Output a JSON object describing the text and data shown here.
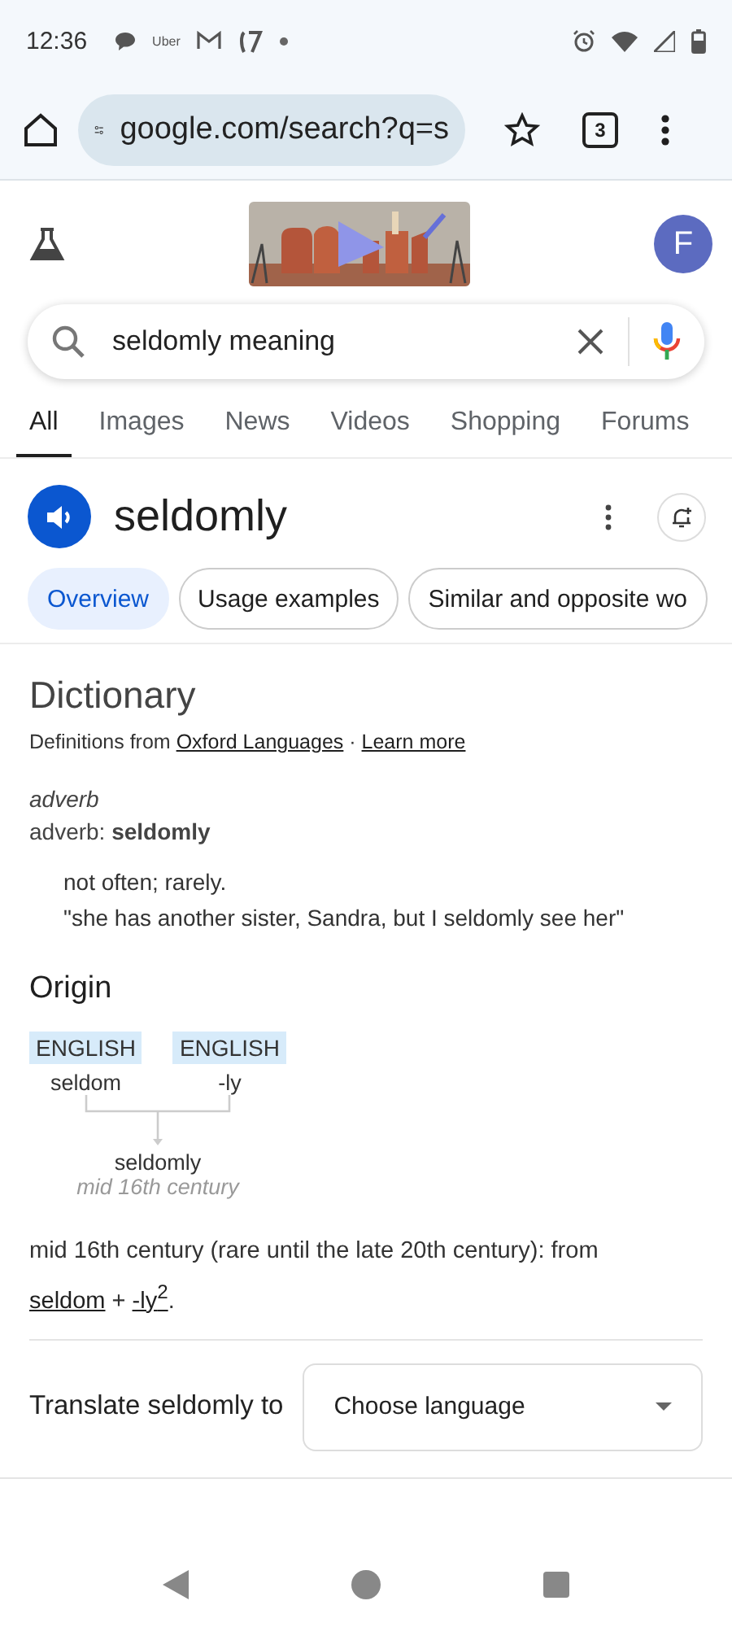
{
  "status_bar": {
    "time": "12:36",
    "notification_label": "Uber"
  },
  "browser": {
    "url": "google.com/search?q=s",
    "tab_count": "3"
  },
  "header": {
    "avatar_letter": "F"
  },
  "search": {
    "value": "seldomly meaning"
  },
  "tabs": [
    {
      "label": "All",
      "selected": true
    },
    {
      "label": "Images",
      "selected": false
    },
    {
      "label": "News",
      "selected": false
    },
    {
      "label": "Videos",
      "selected": false
    },
    {
      "label": "Shopping",
      "selected": false
    },
    {
      "label": "Forums",
      "selected": false
    }
  ],
  "word": "seldomly",
  "chips": [
    {
      "label": "Overview",
      "selected": true
    },
    {
      "label": "Usage examples",
      "selected": false
    },
    {
      "label": "Similar and opposite wo",
      "selected": false
    }
  ],
  "dictionary": {
    "title": "Dictionary",
    "source": [
      {
        "kind": "text",
        "text": "Definitions from "
      },
      {
        "kind": "link",
        "text": "Oxford Languages"
      },
      {
        "kind": "text",
        "text": " · "
      },
      {
        "kind": "link",
        "text": "Learn more"
      }
    ],
    "part_of_speech": "adverb",
    "forms": "adverb: **seldomly**",
    "definition": "not often; rarely.",
    "example": "\"she has another sister, Sandra, but I seldomly see her\""
  },
  "origin": {
    "title": "Origin",
    "roots": [
      {
        "language": "ENGLISH",
        "word": "seldom"
      },
      {
        "language": "ENGLISH",
        "word": "-ly"
      }
    ],
    "result": "seldomly",
    "period": "mid 16th century",
    "etymology": [
      {
        "kind": "text",
        "text": "mid 16th century (rare until the late 20th century): from "
      },
      {
        "kind": "link",
        "text": "seldom"
      },
      {
        "kind": "text",
        "text": " + "
      },
      {
        "kind": "link",
        "text": "-ly$^{2}$"
      },
      {
        "kind": "text",
        "text": "."
      }
    ]
  },
  "translate": {
    "label": "Translate seldomly to",
    "placeholder": "Choose language"
  }
}
